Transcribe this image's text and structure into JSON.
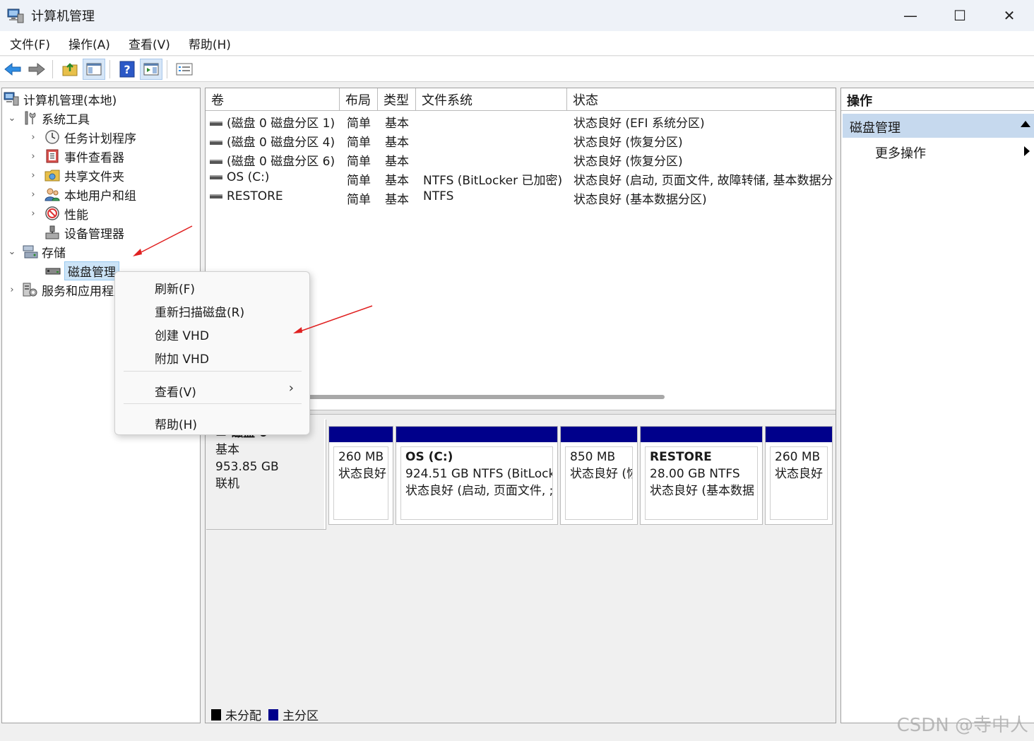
{
  "window": {
    "title": "计算机管理",
    "minimize": "—",
    "maximize": "☐",
    "close": "✕"
  },
  "menubar": [
    "文件(F)",
    "操作(A)",
    "查看(V)",
    "帮助(H)"
  ],
  "tree": {
    "root": "计算机管理(本地)",
    "system_tools": "系统工具",
    "task_scheduler": "任务计划程序",
    "event_viewer": "事件查看器",
    "shared_folders": "共享文件夹",
    "local_users": "本地用户和组",
    "performance": "性能",
    "device_manager": "设备管理器",
    "storage": "存储",
    "disk_management": "磁盘管理",
    "services_apps": "服务和应用程序"
  },
  "volume_list": {
    "columns": [
      "卷",
      "布局",
      "类型",
      "文件系统",
      "状态"
    ],
    "rows": [
      {
        "volume": "(磁盘 0 磁盘分区 1)",
        "layout": "简单",
        "type": "基本",
        "fs": "",
        "status": "状态良好 (EFI 系统分区)"
      },
      {
        "volume": "(磁盘 0 磁盘分区 4)",
        "layout": "简单",
        "type": "基本",
        "fs": "",
        "status": "状态良好 (恢复分区)"
      },
      {
        "volume": "(磁盘 0 磁盘分区 6)",
        "layout": "简单",
        "type": "基本",
        "fs": "",
        "status": "状态良好 (恢复分区)"
      },
      {
        "volume": "OS (C:)",
        "layout": "简单",
        "type": "基本",
        "fs": "NTFS (BitLocker 已加密)",
        "status": "状态良好 (启动, 页面文件, 故障转储, 基本数据分"
      },
      {
        "volume": "RESTORE",
        "layout": "简单",
        "type": "基本",
        "fs": "NTFS",
        "status": "状态良好 (基本数据分区)"
      }
    ]
  },
  "disk": {
    "name": "磁盘 0",
    "type": "基本",
    "size": "953.85 GB",
    "state": "联机",
    "partitions": [
      {
        "name": "",
        "line1": "260 MB",
        "line2": "状态良好"
      },
      {
        "name": "OS  (C:)",
        "line1": "924.51 GB NTFS (BitLocke",
        "line2": "状态良好 (启动, 页面文件, ;"
      },
      {
        "name": "",
        "line1": "850 MB",
        "line2": "状态良好 (恢"
      },
      {
        "name": "RESTORE",
        "line1": "28.00 GB NTFS",
        "line2": "状态良好 (基本数据"
      },
      {
        "name": "",
        "line1": "260 MB",
        "line2": "状态良好"
      }
    ]
  },
  "legend": [
    {
      "label": "未分配",
      "color": "#000000"
    },
    {
      "label": "主分区",
      "color": "#00008b"
    }
  ],
  "actions": {
    "header": "操作",
    "section": "磁盘管理",
    "more": "更多操作"
  },
  "context_menu": {
    "refresh": "刷新(F)",
    "rescan": "重新扫描磁盘(R)",
    "create_vhd": "创建 VHD",
    "attach_vhd": "附加 VHD",
    "view": "查看(V)",
    "help": "帮助(H)"
  },
  "watermark": "CSDN @寺中人",
  "colors": {
    "primary_partition": "#00008b",
    "selection": "#cce4f7",
    "action_section": "#c6d9ee",
    "annotation_arrow": "#e02020"
  }
}
